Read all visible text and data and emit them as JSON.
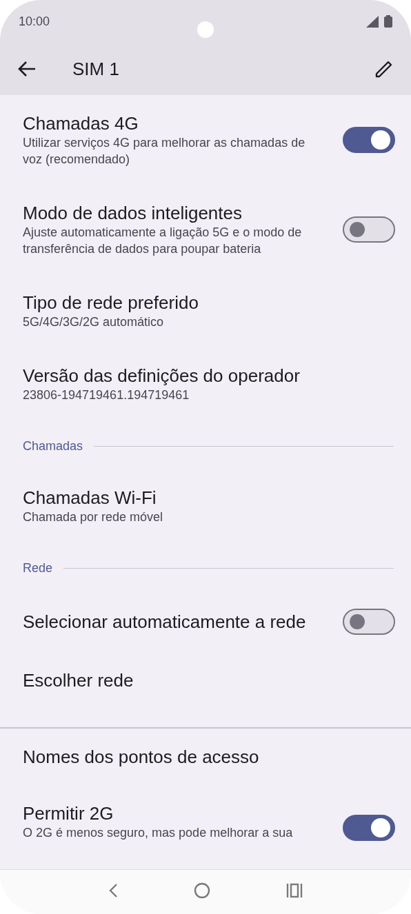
{
  "status_bar": {
    "time": "10:00"
  },
  "app_bar": {
    "title": "SIM 1"
  },
  "items": [
    {
      "kind": "toggle",
      "title": "Chamadas 4G",
      "summary": "Utilizar serviços 4G para melhorar as chamadas de voz (recomendado)",
      "on": true
    },
    {
      "kind": "toggle",
      "title": "Modo de dados inteligentes",
      "summary": "Ajuste automaticamente a ligação 5G e o modo de transferência de dados para poupar bateria",
      "on": false
    },
    {
      "kind": "text",
      "title": "Tipo de rede preferido",
      "summary": "5G/4G/3G/2G automático"
    },
    {
      "kind": "text",
      "title": "Versão das definições do operador",
      "summary": "23806-194719461.194719461"
    },
    {
      "kind": "category",
      "title": "Chamadas"
    },
    {
      "kind": "text",
      "title": "Chamadas Wi-Fi",
      "summary": "Chamada por rede móvel"
    },
    {
      "kind": "category",
      "title": "Rede"
    },
    {
      "kind": "toggle",
      "title": "Selecionar automaticamente a rede",
      "on": false
    },
    {
      "kind": "text",
      "title": "Escolher rede"
    },
    {
      "kind": "divider"
    },
    {
      "kind": "text",
      "title": "Nomes dos pontos de acesso"
    },
    {
      "kind": "toggle",
      "title": "Permitir 2G",
      "summary": "O 2G é menos seguro, mas pode melhorar a sua",
      "on": true
    }
  ]
}
